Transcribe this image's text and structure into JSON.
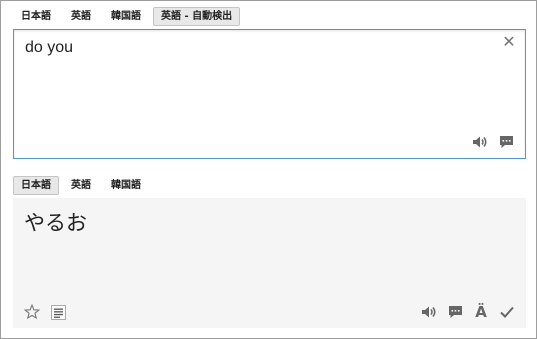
{
  "source_languages": {
    "tabs": [
      {
        "label": "日本語"
      },
      {
        "label": "英語"
      },
      {
        "label": "韓国語"
      },
      {
        "label": "英語 - 自動検出"
      }
    ],
    "selected_index": 3
  },
  "source": {
    "text": "do you",
    "clear_label": "✕"
  },
  "target_languages": {
    "tabs": [
      {
        "label": "日本語"
      },
      {
        "label": "英語"
      },
      {
        "label": "韓国語"
      }
    ],
    "selected_index": 0
  },
  "result": {
    "text": "やるお",
    "spellcheck_letter": "Ä"
  },
  "colors": {
    "focus_border": "#4d90fe",
    "result_bg": "#f5f5f5",
    "icon": "#666666"
  },
  "icons": {
    "source_tools": [
      "speaker-icon",
      "feedback-icon"
    ],
    "result_tools_left": [
      "star-icon",
      "list-icon"
    ],
    "result_tools_right": [
      "speaker-icon",
      "feedback-icon",
      "alternate-chars-icon",
      "check-icon"
    ]
  }
}
